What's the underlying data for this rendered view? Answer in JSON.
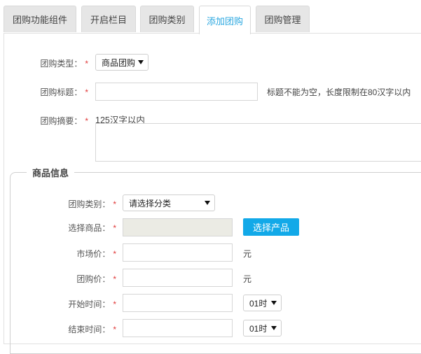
{
  "tabs": [
    {
      "label": "团购功能组件",
      "active": false
    },
    {
      "label": "开启栏目",
      "active": false
    },
    {
      "label": "团购类别",
      "active": false
    },
    {
      "label": "添加团购",
      "active": true
    },
    {
      "label": "团购管理",
      "active": false
    }
  ],
  "required_mark": "*",
  "form": {
    "group_type": {
      "label": "团购类型：",
      "value": "商品团购"
    },
    "group_title": {
      "label": "团购标题：",
      "value": "",
      "hint": "标题不能为空，长度限制在80汉字以内"
    },
    "group_summary": {
      "label": "团购摘要：",
      "hint": "125汉字以内"
    }
  },
  "product_section": {
    "legend": "商品信息",
    "category": {
      "label": "团购类别：",
      "value": "请选择分类"
    },
    "select_product": {
      "label": "选择商品：",
      "button": "选择产品"
    },
    "market_price": {
      "label": "市场价：",
      "unit": "元"
    },
    "group_price": {
      "label": "团购价：",
      "unit": "元"
    },
    "start_time": {
      "label": "开始时间：",
      "hour": "01时"
    },
    "end_time": {
      "label": "结束时间：",
      "hour": "01时"
    }
  },
  "colors": {
    "accent": "#12a9e8",
    "required": "#e03a3a",
    "tab_bg": "#e6e6e6"
  }
}
